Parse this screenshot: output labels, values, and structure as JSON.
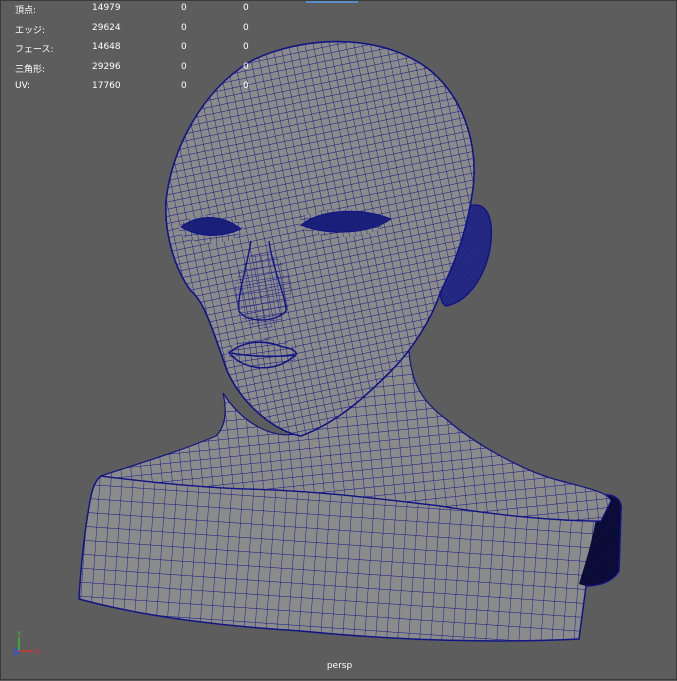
{
  "hud": {
    "rows": [
      {
        "label": "頂点:",
        "v1": "14979",
        "v2": "0",
        "v3": "0"
      },
      {
        "label": "エッジ:",
        "v1": "29624",
        "v2": "0",
        "v3": "0"
      },
      {
        "label": "フェース:",
        "v1": "14648",
        "v2": "0",
        "v3": "0"
      },
      {
        "label": "三角形:",
        "v1": "29296",
        "v2": "0",
        "v3": "0"
      },
      {
        "label": "UV:",
        "v1": "17760",
        "v2": "0",
        "v3": "0"
      }
    ]
  },
  "viewport": {
    "camera": "persp",
    "background": "#5d5d5d",
    "mesh_fill": "#8b8b8b",
    "wire_color": "#101585"
  },
  "axis_gizmo": {
    "x_label": "X",
    "y_label": "Y",
    "z_label": "Z",
    "x_color": "#e03030",
    "y_color": "#30c030",
    "z_color": "#3050ff"
  }
}
